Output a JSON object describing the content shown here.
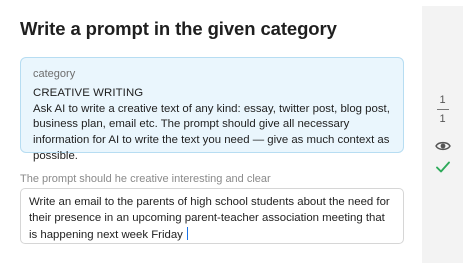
{
  "task": {
    "heading": "Write a prompt in the given category"
  },
  "category_card": {
    "label": "category",
    "title": "CREATIVE WRITING",
    "description": "Ask AI to write a creative text of any kind: essay, twitter post, blog post, business plan, email etc. The prompt should give all necessary information for AI to write the text you need — give as much context as possible."
  },
  "prompt": {
    "hint": "The prompt should he creative interesting and clear",
    "value": "Write an email to the parents of high school students about the need for their presence in an upcoming parent-teacher association meeting that is happening next week Friday"
  },
  "sidebar": {
    "progress_current": "1",
    "progress_total": "1",
    "preview_icon": "eye-icon",
    "status_icon": "check-icon",
    "status_color": "#2eaa5a"
  }
}
